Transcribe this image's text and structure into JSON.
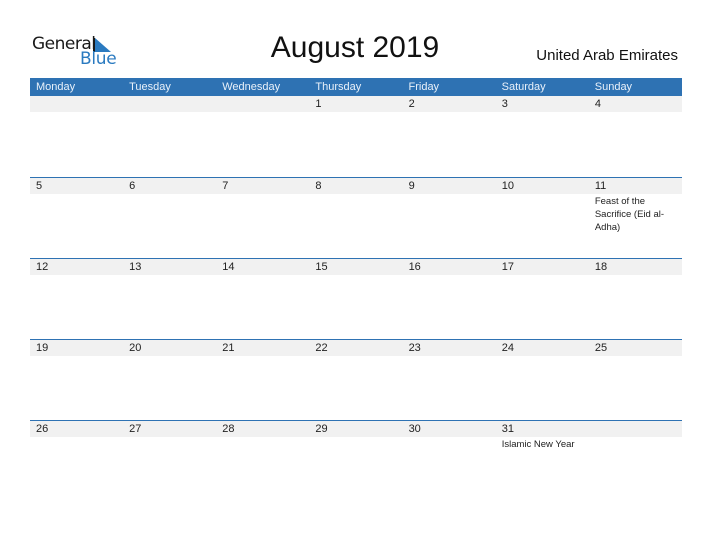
{
  "logo": {
    "word1": "General",
    "word2": "Blue"
  },
  "title": "August 2019",
  "country": "United Arab Emirates",
  "colors": {
    "accent": "#2e72b3",
    "band": "#f1f1f1",
    "logo_blue": "#2a7ac0"
  },
  "weekdays": [
    "Monday",
    "Tuesday",
    "Wednesday",
    "Thursday",
    "Friday",
    "Saturday",
    "Sunday"
  ],
  "weeks": [
    {
      "days": [
        {
          "num": "",
          "event": ""
        },
        {
          "num": "",
          "event": ""
        },
        {
          "num": "",
          "event": ""
        },
        {
          "num": "1",
          "event": ""
        },
        {
          "num": "2",
          "event": ""
        },
        {
          "num": "3",
          "event": ""
        },
        {
          "num": "4",
          "event": ""
        }
      ]
    },
    {
      "days": [
        {
          "num": "5",
          "event": ""
        },
        {
          "num": "6",
          "event": ""
        },
        {
          "num": "7",
          "event": ""
        },
        {
          "num": "8",
          "event": ""
        },
        {
          "num": "9",
          "event": ""
        },
        {
          "num": "10",
          "event": ""
        },
        {
          "num": "11",
          "event": "Feast of the Sacrifice (Eid al-Adha)"
        }
      ]
    },
    {
      "days": [
        {
          "num": "12",
          "event": ""
        },
        {
          "num": "13",
          "event": ""
        },
        {
          "num": "14",
          "event": ""
        },
        {
          "num": "15",
          "event": ""
        },
        {
          "num": "16",
          "event": ""
        },
        {
          "num": "17",
          "event": ""
        },
        {
          "num": "18",
          "event": ""
        }
      ]
    },
    {
      "days": [
        {
          "num": "19",
          "event": ""
        },
        {
          "num": "20",
          "event": ""
        },
        {
          "num": "21",
          "event": ""
        },
        {
          "num": "22",
          "event": ""
        },
        {
          "num": "23",
          "event": ""
        },
        {
          "num": "24",
          "event": ""
        },
        {
          "num": "25",
          "event": ""
        }
      ]
    },
    {
      "days": [
        {
          "num": "26",
          "event": ""
        },
        {
          "num": "27",
          "event": ""
        },
        {
          "num": "28",
          "event": ""
        },
        {
          "num": "29",
          "event": ""
        },
        {
          "num": "30",
          "event": ""
        },
        {
          "num": "31",
          "event": "Islamic New Year"
        },
        {
          "num": "",
          "event": ""
        }
      ]
    }
  ]
}
